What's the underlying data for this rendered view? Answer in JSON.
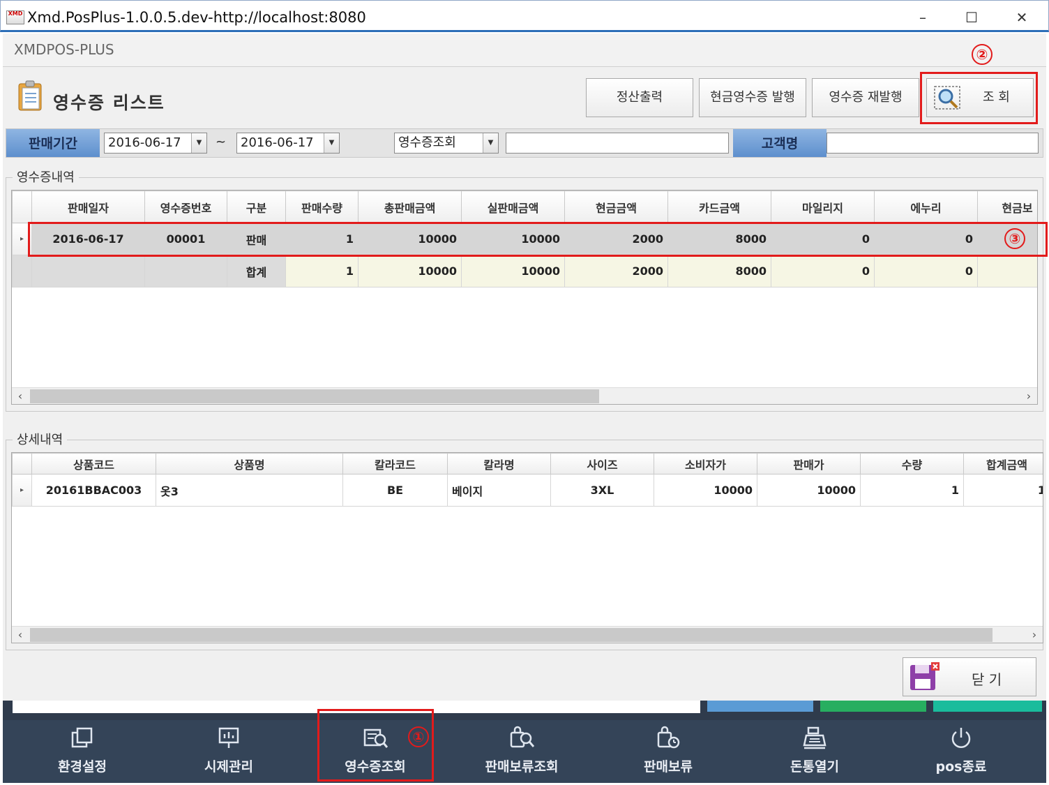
{
  "window": {
    "title": "Xmd.PosPlus-1.0.0.5.dev-http://localhost:8080",
    "minimize": "–",
    "maximize": "☐",
    "close": "✕"
  },
  "app": {
    "name": "XMDPOS-PLUS"
  },
  "page": {
    "title": "영수증 리스트"
  },
  "toolbar": {
    "settlement_print": "정산출력",
    "cash_receipt_issue": "현금영수증 발행",
    "receipt_reissue": "영수증 재발행",
    "search": "조 회"
  },
  "filter": {
    "period_label": "판매기간",
    "date_from": "2016-06-17",
    "tilde": "~",
    "date_to": "2016-06-17",
    "query_type": "영수증조회",
    "query_value": "",
    "customer_label": "고객명",
    "customer_value": ""
  },
  "receipts": {
    "group_label": "영수증내역",
    "columns": [
      "판매일자",
      "영수증번호",
      "구분",
      "판매수량",
      "총판매금액",
      "실판매금액",
      "현금금액",
      "카드금액",
      "마일리지",
      "에누리",
      "현금보"
    ],
    "rows": [
      [
        "2016-06-17",
        "00001",
        "판매",
        "1",
        "10000",
        "10000",
        "2000",
        "8000",
        "0",
        "0",
        ""
      ]
    ],
    "sum_row": [
      "",
      "",
      "합계",
      "1",
      "10000",
      "10000",
      "2000",
      "8000",
      "0",
      "0",
      ""
    ],
    "row_marker": "▸"
  },
  "details": {
    "group_label": "상세내역",
    "columns": [
      "상품코드",
      "상품명",
      "칼라코드",
      "칼라명",
      "사이즈",
      "소비자가",
      "판매가",
      "수량",
      "합계금액"
    ],
    "rows": [
      [
        "20161BBAC003",
        "옷3",
        "BE",
        "베이지",
        "3XL",
        "10000",
        "10000",
        "1",
        "1"
      ]
    ]
  },
  "close_button": {
    "label": "닫 기"
  },
  "footer": {
    "items": [
      {
        "label": "환경설정",
        "icon": "copy-icon"
      },
      {
        "label": "시제관리",
        "icon": "presentation-icon"
      },
      {
        "label": "영수증조회",
        "icon": "receipt-search-icon"
      },
      {
        "label": "판매보류조회",
        "icon": "hold-search-icon"
      },
      {
        "label": "판매보류",
        "icon": "bag-clock-icon"
      },
      {
        "label": "돈통열기",
        "icon": "register-icon"
      },
      {
        "label": "pos종료",
        "icon": "power-icon"
      }
    ]
  },
  "annotations": {
    "n1": "①",
    "n2": "②",
    "n3": "③"
  },
  "colors": {
    "accent_blue": "#5d8fcd",
    "footer_bg": "#344458",
    "annotation_red": "#e21b1b",
    "strip_blue": "#5a9bd5",
    "strip_green": "#27ae60",
    "strip_teal": "#1abc9c"
  }
}
